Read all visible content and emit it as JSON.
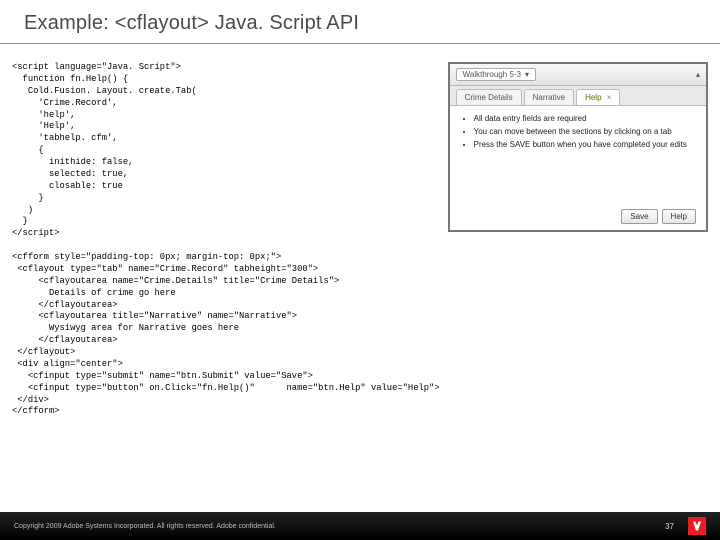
{
  "title": "Example: <cflayout> Java. Script API",
  "code": "<script language=\"Java. Script\">\n  function fn.Help() {\n   Cold.Fusion. Layout. create.Tab(\n     'Crime.Record',\n     'help',\n     'Help',\n     'tabhelp. cfm',\n     {\n       inithide: false,\n       selected: true,\n       closable: true\n     }\n   )\n  }\n</script>\n\n<cfform style=\"padding-top: 0px; margin-top: 0px;\">\n <cflayout type=\"tab\" name=\"Crime.Record\" tabheight=\"300\">\n     <cflayoutarea name=\"Crime.Details\" title=\"Crime Details\">\n       Details of crime go here\n     </cflayoutarea>\n     <cflayoutarea title=\"Narrative\" name=\"Narrative\">\n       Wysiwyg area for Narrative goes here\n     </cflayoutarea>\n </cflayout>\n <div align=\"center\">\n   <cfinput type=\"submit\" name=\"btn.Submit\" value=\"Save\">\n   <cfinput type=\"button\" on.Click=\"fn.Help()\"      name=\"btn.Help\" value=\"Help\">\n </div>\n</cfform>",
  "screenshot": {
    "toolbar_label": "Walkthrough 5-3",
    "tabs": [
      {
        "label": "Crime Details",
        "closable": false
      },
      {
        "label": "Narrative",
        "closable": false
      },
      {
        "label": "Help",
        "closable": true,
        "active": true
      }
    ],
    "bullets": [
      "All data entry fields are required",
      "You can move between the sections by clicking on a tab",
      "Press the SAVE button when you have completed your edits"
    ],
    "buttons": {
      "save": "Save",
      "help": "Help"
    }
  },
  "footer": {
    "copyright": "Copyright 2009 Adobe Systems Incorporated.  All rights reserved.  Adobe confidential.",
    "page": "37"
  }
}
